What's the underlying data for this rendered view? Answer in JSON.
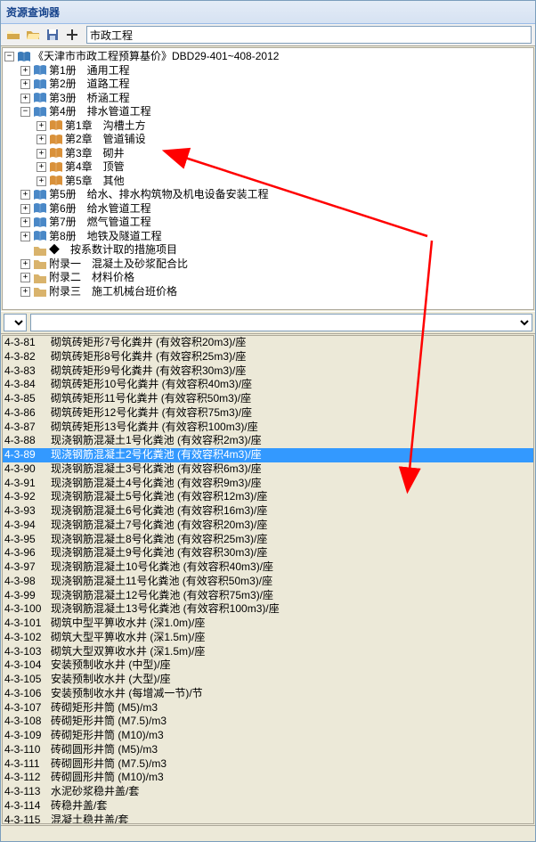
{
  "window": {
    "title": "资源查询器"
  },
  "toolbar": {
    "search_value": "市政工程"
  },
  "tree": {
    "root": "《天津市市政工程预算基价》DBD29-401~408-2012",
    "vol1": "第1册　通用工程",
    "vol2": "第2册　道路工程",
    "vol3": "第3册　桥涵工程",
    "vol4": "第4册　排水管道工程",
    "ch1": "第1章　沟槽土方",
    "ch2": "第2章　管道铺设",
    "ch3": "第3章　砌井",
    "ch4": "第4章　顶管",
    "ch5": "第5章　其他",
    "vol5": "第5册　给水、排水构筑物及机电设备安装工程",
    "vol6": "第6册　给水管道工程",
    "vol7": "第7册　燃气管道工程",
    "vol8": "第8册　地铁及隧道工程",
    "misc": "◆　按系数计取的措施项目",
    "app1": "附录一　混凝土及砂浆配合比",
    "app2": "附录二　材料价格",
    "app3": "附录三　施工机械台班价格"
  },
  "list": [
    {
      "code": "4-3-81",
      "desc": "砌筑砖矩形7号化粪井 (有效容积20m3)/座"
    },
    {
      "code": "4-3-82",
      "desc": "砌筑砖矩形8号化粪井 (有效容积25m3)/座"
    },
    {
      "code": "4-3-83",
      "desc": "砌筑砖矩形9号化粪井 (有效容积30m3)/座"
    },
    {
      "code": "4-3-84",
      "desc": "砌筑砖矩形10号化粪井 (有效容积40m3)/座"
    },
    {
      "code": "4-3-85",
      "desc": "砌筑砖矩形11号化粪井 (有效容积50m3)/座"
    },
    {
      "code": "4-3-86",
      "desc": "砌筑砖矩形12号化粪井 (有效容积75m3)/座"
    },
    {
      "code": "4-3-87",
      "desc": "砌筑砖矩形13号化粪井 (有效容积100m3)/座"
    },
    {
      "code": "4-3-88",
      "desc": "现浇钢筋混凝土1号化粪池 (有效容积2m3)/座"
    },
    {
      "code": "4-3-89",
      "desc": "现浇钢筋混凝土2号化粪池 (有效容积4m3)/座",
      "selected": true
    },
    {
      "code": "4-3-90",
      "desc": "现浇钢筋混凝土3号化粪池 (有效容积6m3)/座"
    },
    {
      "code": "4-3-91",
      "desc": "现浇钢筋混凝土4号化粪池 (有效容积9m3)/座"
    },
    {
      "code": "4-3-92",
      "desc": "现浇钢筋混凝土5号化粪池 (有效容积12m3)/座"
    },
    {
      "code": "4-3-93",
      "desc": "现浇钢筋混凝土6号化粪池 (有效容积16m3)/座"
    },
    {
      "code": "4-3-94",
      "desc": "现浇钢筋混凝土7号化粪池 (有效容积20m3)/座"
    },
    {
      "code": "4-3-95",
      "desc": "现浇钢筋混凝土8号化粪池 (有效容积25m3)/座"
    },
    {
      "code": "4-3-96",
      "desc": "现浇钢筋混凝土9号化粪池 (有效容积30m3)/座"
    },
    {
      "code": "4-3-97",
      "desc": "现浇钢筋混凝土10号化粪池 (有效容积40m3)/座"
    },
    {
      "code": "4-3-98",
      "desc": "现浇钢筋混凝土11号化粪池 (有效容积50m3)/座"
    },
    {
      "code": "4-3-99",
      "desc": "现浇钢筋混凝土12号化粪池 (有效容积75m3)/座"
    },
    {
      "code": "4-3-100",
      "desc": "现浇钢筋混凝土13号化粪池 (有效容积100m3)/座"
    },
    {
      "code": "4-3-101",
      "desc": "砌筑中型平箅收水井 (深1.0m)/座"
    },
    {
      "code": "4-3-102",
      "desc": "砌筑大型平箅收水井 (深1.5m)/座"
    },
    {
      "code": "4-3-103",
      "desc": "砌筑大型双箅收水井 (深1.5m)/座"
    },
    {
      "code": "4-3-104",
      "desc": "安装预制收水井 (中型)/座"
    },
    {
      "code": "4-3-105",
      "desc": "安装预制收水井 (大型)/座"
    },
    {
      "code": "4-3-106",
      "desc": "安装预制收水井 (每增减一节)/节"
    },
    {
      "code": "4-3-107",
      "desc": "砖砌矩形井筒 (M5)/m3"
    },
    {
      "code": "4-3-108",
      "desc": "砖砌矩形井筒 (M7.5)/m3"
    },
    {
      "code": "4-3-109",
      "desc": "砖砌矩形井筒 (M10)/m3"
    },
    {
      "code": "4-3-110",
      "desc": "砖砌圆形井筒 (M5)/m3"
    },
    {
      "code": "4-3-111",
      "desc": "砖砌圆形井筒 (M7.5)/m3"
    },
    {
      "code": "4-3-112",
      "desc": "砖砌圆形井筒 (M10)/m3"
    },
    {
      "code": "4-3-113",
      "desc": "水泥砂浆稳井盖/套"
    },
    {
      "code": "4-3-114",
      "desc": "砖稳井盖/套"
    },
    {
      "code": "4-3-115",
      "desc": "混凝土稳井盖/套"
    }
  ]
}
